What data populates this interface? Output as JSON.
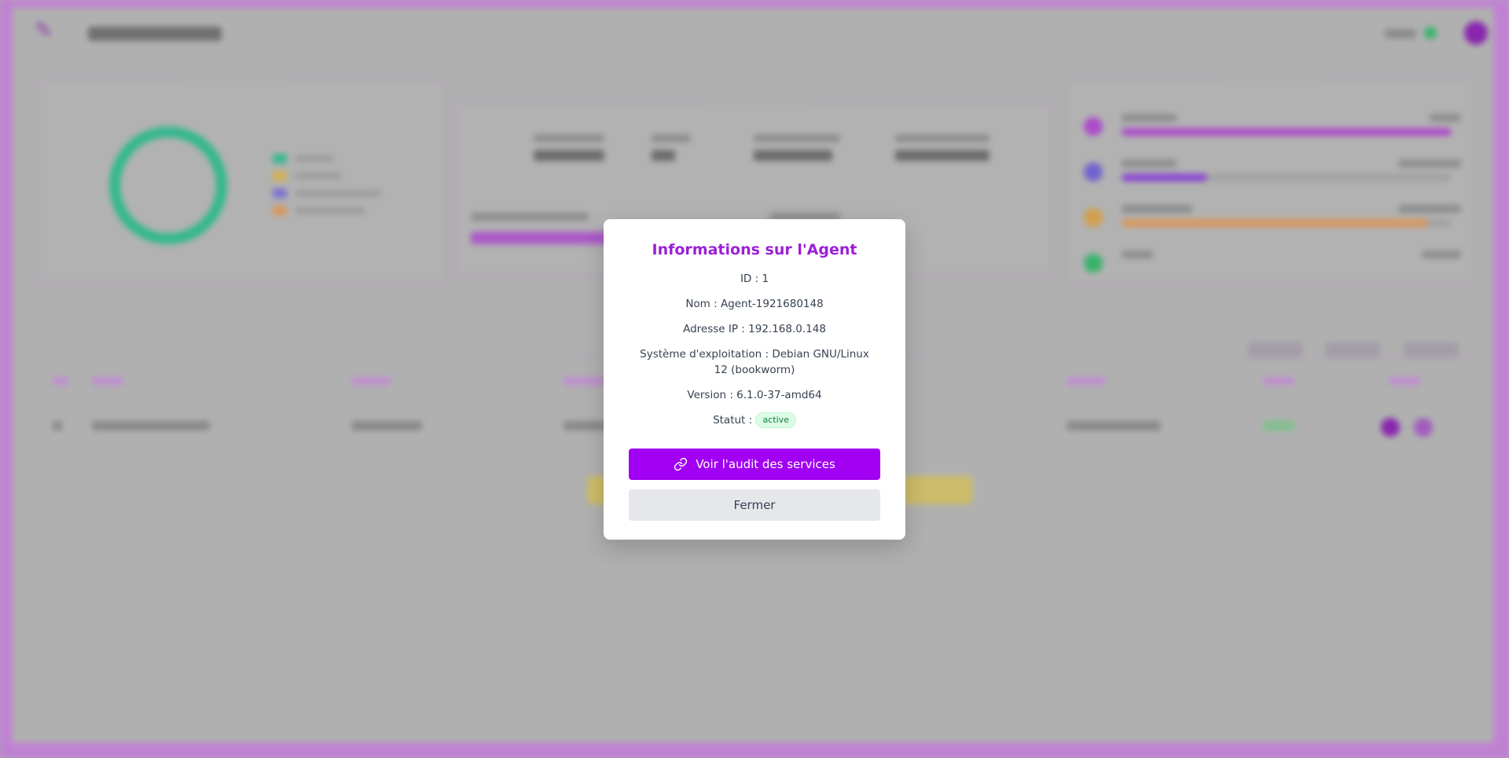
{
  "modal": {
    "title": "Informations sur l'Agent",
    "id_line": "ID : 1",
    "name_line": "Nom : Agent-1921680148",
    "ip_line": "Adresse IP : 192.168.0.148",
    "os_line": "Système d'exploitation : Debian GNU/Linux 12 (bookworm)",
    "version_line": "Version : 6.1.0-37-amd64",
    "status_label": "Statut :",
    "status_value": "active",
    "primary_button": "Voir l'audit des services",
    "close_button": "Fermer"
  },
  "colors": {
    "accent": "#a100f2",
    "title": "#9b1fd6",
    "status_green": "#15803d",
    "donut_green": "#2ebd8f"
  },
  "icons": {
    "primary_button_icon": "link-icon"
  }
}
